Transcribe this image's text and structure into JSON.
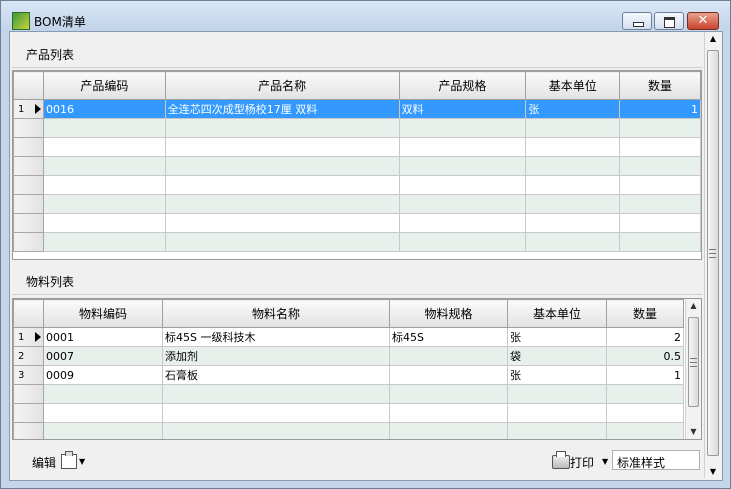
{
  "window": {
    "title": "BOM清单",
    "close_glyph": "✕"
  },
  "product_section": {
    "title": "产品列表",
    "columns": [
      "产品编码",
      "产品名称",
      "产品规格",
      "基本单位",
      "数量"
    ],
    "rows": [
      {
        "index": "1",
        "code": "0016",
        "name": "全连芯四次成型杨校17厘  双料",
        "spec": "双料",
        "unit": "张",
        "qty": "1"
      }
    ]
  },
  "material_section": {
    "title": "物料列表",
    "columns": [
      "物料编码",
      "物料名称",
      "物料规格",
      "基本单位",
      "数量"
    ],
    "rows": [
      {
        "index": "1",
        "code": "0001",
        "name": "标45S 一级科技木",
        "spec": "标45S",
        "unit": "张",
        "qty": "2"
      },
      {
        "index": "2",
        "code": "0007",
        "name": "添加剂",
        "spec": "",
        "unit": "袋",
        "qty": "0.5"
      },
      {
        "index": "3",
        "code": "0009",
        "name": "石膏板",
        "spec": "",
        "unit": "张",
        "qty": "1"
      }
    ]
  },
  "toolbar": {
    "edit_label": "编辑",
    "print_label": "打印",
    "style_value": "标准样式"
  },
  "scroll": {
    "up_glyph": "▲",
    "down_glyph": "▼"
  }
}
